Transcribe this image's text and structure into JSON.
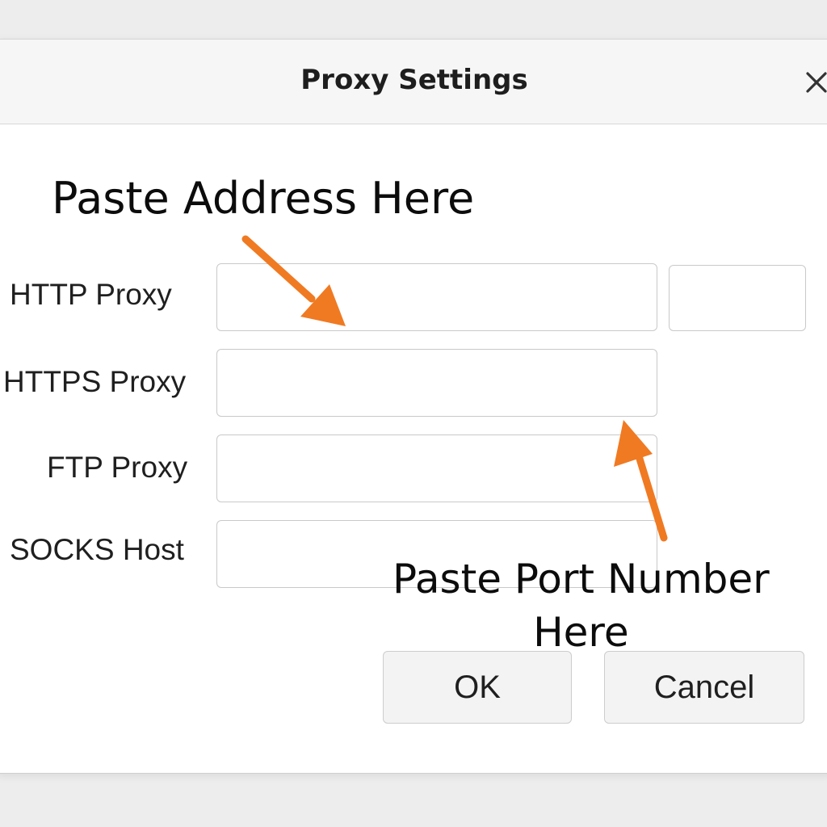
{
  "dialog": {
    "title": "Proxy Settings",
    "close_icon": "close-icon"
  },
  "annotations": {
    "address_hint": "Paste Address Here",
    "port_hint_line1": "Paste Port Number",
    "port_hint_line2": "Here",
    "arrow_color": "#f07a22"
  },
  "fields": {
    "http_label": "HTTP Proxy",
    "https_label": "HTTPS Proxy",
    "ftp_label": "FTP Proxy",
    "socks_label": "SOCKS Host",
    "http_value": "",
    "http_port_value": "",
    "https_value": "",
    "ftp_value": "",
    "socks_value": ""
  },
  "buttons": {
    "ok_label": "OK",
    "cancel_label": "Cancel"
  }
}
